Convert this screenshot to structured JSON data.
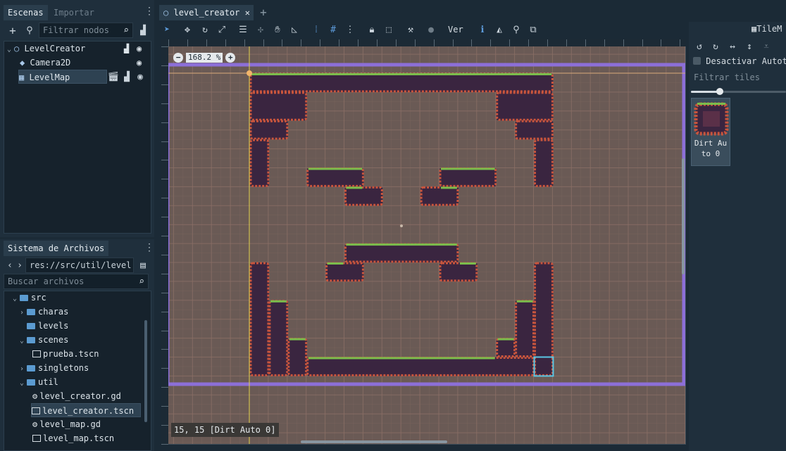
{
  "left_dock": {
    "tabs": [
      {
        "label": "Escenas"
      },
      {
        "label": "Importar"
      }
    ],
    "filter_placeholder": "Filtrar nodos",
    "scene_tree": [
      {
        "label": "LevelCreator",
        "icon": "node2d-icon"
      },
      {
        "label": "Camera2D",
        "icon": "camera-icon"
      },
      {
        "label": "LevelMap",
        "icon": "tilemap-icon"
      }
    ]
  },
  "filesystem": {
    "tab": "Sistema de Archivos",
    "path": "res://src/util/level",
    "search_placeholder": "Buscar archivos",
    "items": [
      {
        "label": "src"
      },
      {
        "label": "charas"
      },
      {
        "label": "levels"
      },
      {
        "label": "scenes"
      },
      {
        "label": "prueba.tscn"
      },
      {
        "label": "singletons"
      },
      {
        "label": "util"
      },
      {
        "label": "level_creator.gd"
      },
      {
        "label": "level_creator.tscn"
      },
      {
        "label": "level_map.gd"
      },
      {
        "label": "level_map.tscn"
      }
    ]
  },
  "editor": {
    "tab_label": "level_creator",
    "close_glyph": "✕",
    "add_tab_glyph": "+",
    "toolbar_view_label": "Ver",
    "zoom": "168.2 %",
    "zoom_out": "−",
    "zoom_in": "+",
    "status": "15, 15 [Dirt Auto 0]"
  },
  "tilemap_panel": {
    "title": "TileM",
    "disable_autotile": "Desactivar Autoti",
    "filter_placeholder": "Filtrar tiles",
    "zoom_fraction": 0.3,
    "tile_label_line1": "Dirt Au",
    "tile_label_line2": "to 0"
  },
  "colors": {
    "accent": "#5c9ad9",
    "boundary": "#8c6fd8",
    "guide": "#e2d34d",
    "selection": "#59c8e6",
    "tile_dark": "#3a2540",
    "tile_edge": "#c8553d",
    "grass": "#7bbd4c",
    "grid": "#8a6f66",
    "canvas": "#6a5a55"
  }
}
